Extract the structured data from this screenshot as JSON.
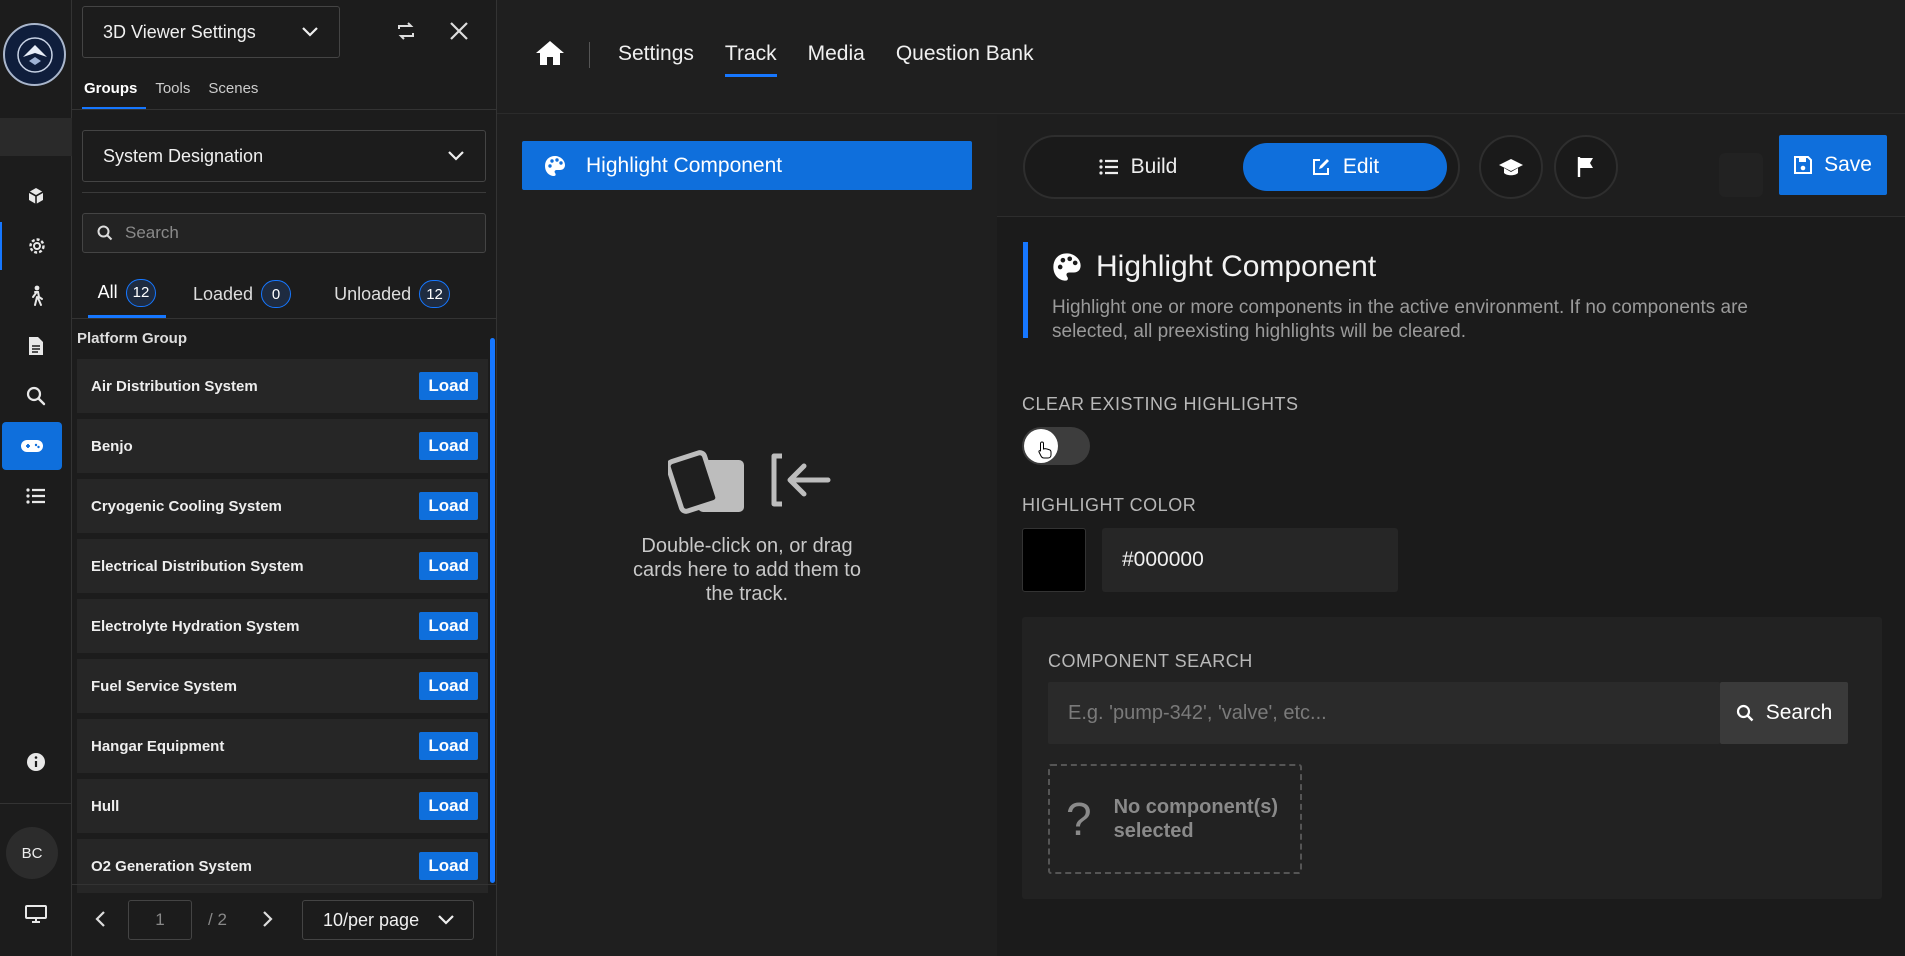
{
  "panel": {
    "title_dropdown": "3D Viewer Settings",
    "tabs": [
      {
        "label": "Groups",
        "active": true
      },
      {
        "label": "Tools",
        "active": false
      },
      {
        "label": "Scenes",
        "active": false
      }
    ],
    "designation_dropdown": "System Designation",
    "search_placeholder": "Search",
    "filter_tabs": [
      {
        "label": "All",
        "count": "12",
        "active": true
      },
      {
        "label": "Loaded",
        "count": "0",
        "active": false
      },
      {
        "label": "Unloaded",
        "count": "12",
        "active": false
      }
    ],
    "group_title": "Platform Group",
    "load_label": "Load",
    "items": [
      "Air Distribution System",
      "Benjo",
      "Cryogenic Cooling System",
      "Electrical Distribution System",
      "Electrolyte Hydration System",
      "Fuel Service System",
      "Hangar Equipment",
      "Hull",
      "O2 Generation System"
    ],
    "pagination": {
      "page": "1",
      "total": "/ 2",
      "per_page": "10/per page"
    }
  },
  "rail": {
    "icons": [
      "cube-icon",
      "gear-icon",
      "walking-person-icon",
      "document-icon",
      "search-icon",
      "gamepad-icon",
      "list-icon",
      "info-icon",
      "monitor-icon"
    ],
    "avatar_initials": "BC"
  },
  "topnav": {
    "links": [
      {
        "label": "Settings",
        "active": false
      },
      {
        "label": "Track",
        "active": true
      },
      {
        "label": "Media",
        "active": false
      },
      {
        "label": "Question Bank",
        "active": false
      }
    ]
  },
  "track": {
    "card_label": "Highlight Component",
    "drop_text": "Double-click on, or drag cards here to add them to the track."
  },
  "editor": {
    "build_label": "Build",
    "edit_label": "Edit",
    "save_label": "Save",
    "section_title": "Highlight Component",
    "section_desc": "Highlight one or more components in the active environment. If no components are selected, all preexisting highlights will be cleared.",
    "clear_label": "CLEAR EXISTING HIGHLIGHTS",
    "clear_enabled": false,
    "color_label": "HIGHLIGHT COLOR",
    "color_value": "#000000",
    "search_label": "COMPONENT SEARCH",
    "search_placeholder": "E.g. 'pump-342', 'valve', etc...",
    "search_button": "Search",
    "no_component_text": "No component(s) selected"
  },
  "colors": {
    "accent": "#0f6fdc",
    "background": "#1f1f1f"
  }
}
